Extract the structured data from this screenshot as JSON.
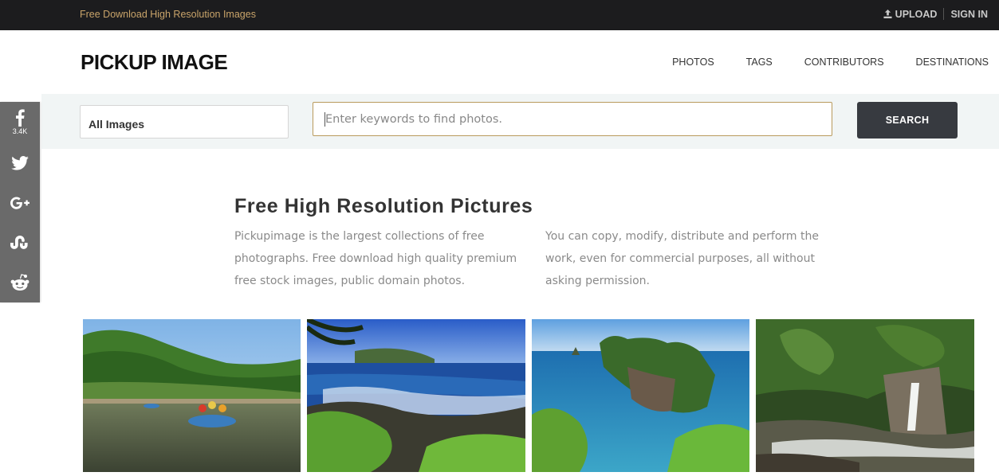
{
  "topbar": {
    "tagline": "Free Download High Resolution Images",
    "upload_label": "UPLOAD",
    "signin_label": "SIGN IN"
  },
  "header": {
    "logo": "PICKUP IMAGE",
    "nav": [
      "PHOTOS",
      "TAGS",
      "CONTRIBUTORS",
      "DESTINATIONS"
    ]
  },
  "search": {
    "select_value": "All Images",
    "placeholder": "Enter keywords to find photos.",
    "button_label": "SEARCH"
  },
  "social": {
    "items": [
      {
        "icon": "facebook-icon",
        "count": "3.4K"
      },
      {
        "icon": "twitter-icon"
      },
      {
        "icon": "google-plus-icon"
      },
      {
        "icon": "stumbleupon-icon"
      },
      {
        "icon": "reddit-icon"
      }
    ]
  },
  "intro": {
    "title": "Free High Resolution Pictures",
    "left_text": "Pickupimage is the largest collections of free photographs. Free download high quality premium free stock images, public domain photos.",
    "right_text": "You can copy, modify, distribute and perform the work, even for commercial purposes, all without asking permission."
  },
  "photos": [
    {
      "subject": "river-rafting"
    },
    {
      "subject": "tropical-coast"
    },
    {
      "subject": "sea-cliff-island"
    },
    {
      "subject": "forest-waterfall"
    }
  ],
  "colors": {
    "topbar_bg": "#1c1c1e",
    "tagline": "#c9a46a",
    "search_border": "#b99a5c",
    "search_button": "#373a40",
    "social_bg": "#6a6a6a",
    "strip_bg": "#f1f5f5"
  }
}
